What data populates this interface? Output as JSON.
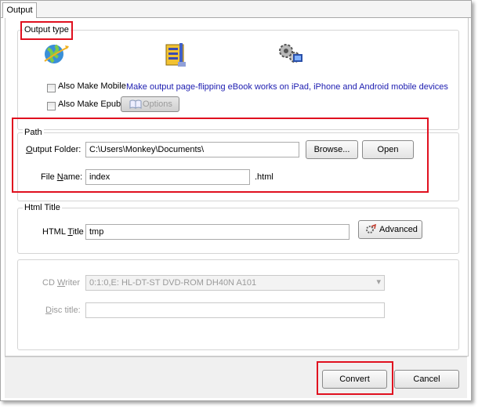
{
  "tabs": [
    {
      "label": "Output"
    }
  ],
  "output_type": {
    "title": "Output type",
    "icons": [
      "globe-icon",
      "zip-archive-icon",
      "gears-icon"
    ],
    "mobile": {
      "label": "Also Make Mobile",
      "checked": false,
      "description": "Make output page-flipping eBook works on iPad, iPhone and Android mobile devices"
    },
    "epub": {
      "label": "Also Make Epub",
      "checked": false,
      "options_button": "Options"
    }
  },
  "path": {
    "title": "Path",
    "output_folder": {
      "label_pre": "",
      "label_u": "O",
      "label_post": "utput Folder:",
      "value": "C:\\Users\\Monkey\\Documents\\"
    },
    "browse_button": "Browse...",
    "open_button": "Open",
    "file_name": {
      "label_pre": "File ",
      "label_u": "N",
      "label_post": "ame:",
      "value": "index",
      "extension": ".html"
    }
  },
  "html_title": {
    "title": "Html Title",
    "label_pre": "HTML ",
    "label_u": "T",
    "label_post": "itle",
    "value": "tmp",
    "advanced_button": "Advanced"
  },
  "cd": {
    "writer": {
      "label_pre": "CD ",
      "label_u": "W",
      "label_post": "riter",
      "value": "0:1:0,E: HL-DT-ST DVD-ROM DH40N    A101"
    },
    "disc_title": {
      "label_pre": "",
      "label_u": "D",
      "label_post": "isc title:",
      "value": ""
    }
  },
  "footer": {
    "convert_button": "Convert",
    "cancel_button": "Cancel"
  },
  "colors": {
    "highlight": "#e0101f",
    "link": "#1c1cb0"
  }
}
